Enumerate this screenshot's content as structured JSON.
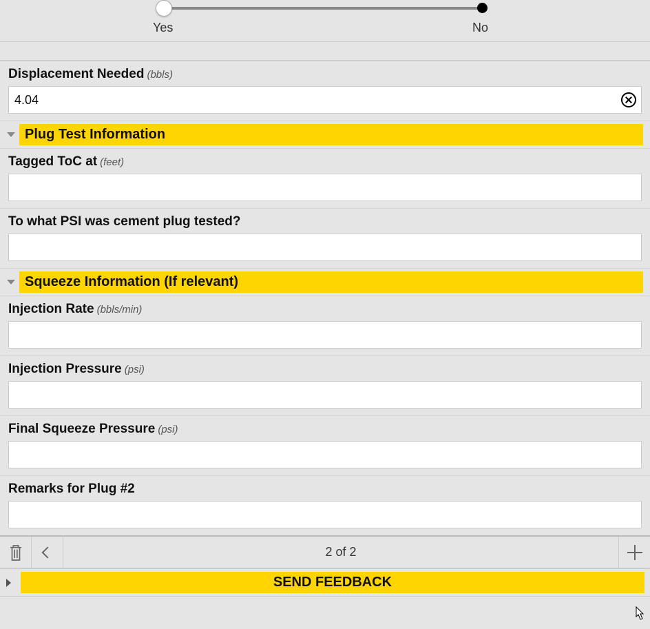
{
  "slider": {
    "option_yes": "Yes",
    "option_no": "No"
  },
  "fields": {
    "displacement": {
      "label": "Displacement Needed",
      "unit": "(bbls)",
      "value": "4.04"
    },
    "tagged_toc": {
      "label": "Tagged ToC at",
      "unit": "(feet)",
      "value": ""
    },
    "psi_tested": {
      "label": "To what PSI was cement plug tested?",
      "value": ""
    },
    "injection_rate": {
      "label": "Injection Rate",
      "unit": "(bbls/min)",
      "value": ""
    },
    "injection_pressure": {
      "label": "Injection Pressure",
      "unit": "(psi)",
      "value": ""
    },
    "final_squeeze": {
      "label": "Final Squeeze Pressure",
      "unit": "(psi)",
      "value": ""
    },
    "remarks": {
      "label": "Remarks for Plug #2",
      "value": ""
    }
  },
  "sections": {
    "plug_test": "Plug Test Information",
    "squeeze": "Squeeze Information (If relevant)"
  },
  "pager": {
    "text": "2 of 2"
  },
  "feedback": {
    "label": "SEND FEEDBACK"
  }
}
